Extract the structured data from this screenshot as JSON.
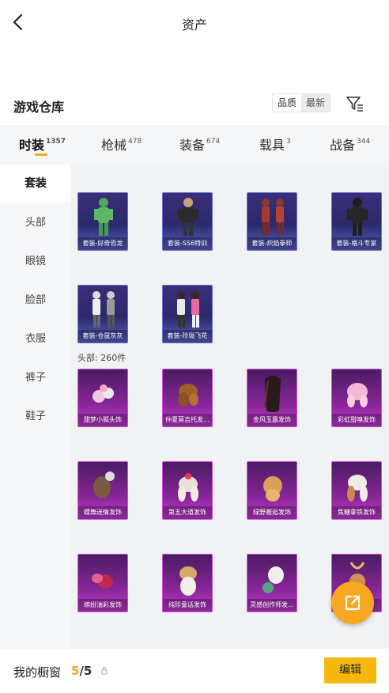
{
  "header": {
    "title": "资产"
  },
  "warehouse": {
    "title": "游戏仓库",
    "sort_options": [
      "品质",
      "最新"
    ],
    "sort_active_index": 1,
    "filter_icon": "filter-icon"
  },
  "tabs": [
    {
      "label": "时装",
      "count": "1357"
    },
    {
      "label": "枪械",
      "count": "478"
    },
    {
      "label": "装备",
      "count": "674"
    },
    {
      "label": "载具",
      "count": "3"
    },
    {
      "label": "战备",
      "count": "344"
    }
  ],
  "sidebar": [
    "套装",
    "头部",
    "眼镜",
    "脸部",
    "衣服",
    "裤子",
    "鞋子"
  ],
  "suits": [
    "套装-好奇恐龙",
    "套装-SS6特训",
    "套装-炽焰拳师",
    "套装-格斗专家",
    "套装-仓鼠灰灰",
    "套装-玲珑飞花"
  ],
  "head_section": {
    "label": "头部: 260件"
  },
  "heads": [
    "甜梦小狐头饰",
    "仲夏莫吉托发...",
    "金风玉露发饰",
    "彩虹甜嗅发饰",
    "蝶舞迷情发饰",
    "第五大道发饰",
    "绿野邂逅发饰",
    "焦糖拿铁发饰",
    "缤纷油彩发饰",
    "纯珍童话发饰",
    "灵感创作师发...",
    "发饰"
  ],
  "fab": {
    "icon": "share-external-icon"
  },
  "bottom_bar": {
    "label": "我的橱窗",
    "current": "5",
    "total": "/5",
    "edit_label": "编辑"
  },
  "colors": {
    "accent": "#f5a623",
    "button": "#f5b80f",
    "suit_card": "#3b2d7a",
    "head_card": "#862596"
  }
}
